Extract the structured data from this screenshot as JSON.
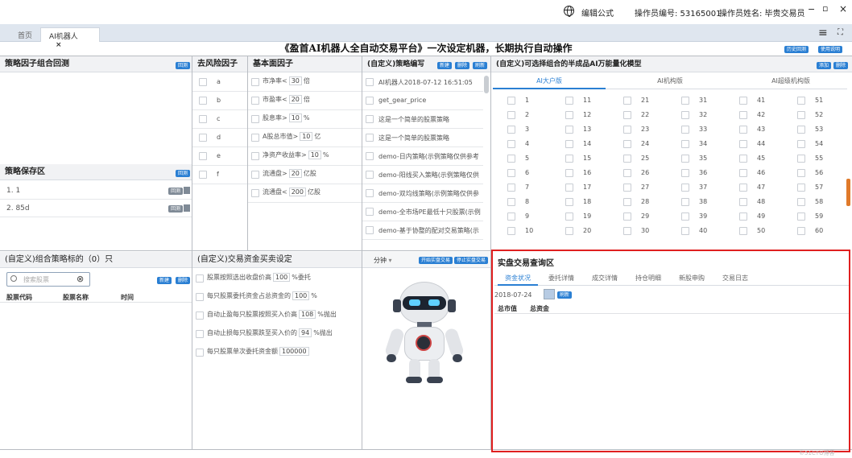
{
  "topbar": {
    "formula": "编辑公式",
    "operator_id": "操作员编号: 53165001",
    "operator_name": "操作员姓名: 毕贵交易员",
    "min": "−",
    "restore": "▫",
    "close": "×",
    "menu": "≡",
    "expand": "⛶"
  },
  "tabs": [
    {
      "label": "首页"
    },
    {
      "label": "AI机器人"
    }
  ],
  "tab_close": "×",
  "main_title": "《盈首AI机器人全自动交易平台》一次设定机器，长期执行自动操作",
  "header_buttons": {
    "history": "历史回测",
    "help": "使用说明"
  },
  "backtest": {
    "title": "策略因子组合回测",
    "btn": "回测"
  },
  "save": {
    "title": "策略保存区",
    "btn": "回测",
    "items": [
      {
        "label": "1.  1",
        "btn": "回测"
      },
      {
        "label": "2.  85d",
        "btn": "回测"
      }
    ]
  },
  "risk": {
    "title": "去风险因子",
    "items": [
      "a",
      "b",
      "c",
      "d",
      "e",
      "f"
    ]
  },
  "fundamental": {
    "title": "基本面因子",
    "items": [
      {
        "pre": "市净率<",
        "val": "30",
        "unit": "倍"
      },
      {
        "pre": "市盈率<",
        "val": "20",
        "unit": "倍"
      },
      {
        "pre": "股息率>",
        "val": "10",
        "unit": "%"
      },
      {
        "pre": "A股总市值>",
        "val": "10",
        "unit": "亿"
      },
      {
        "pre": "净资产收益率>",
        "val": "10",
        "unit": "%"
      },
      {
        "pre": "流通盘>",
        "val": "20",
        "unit": "亿股"
      },
      {
        "pre": "流通盘<",
        "val": "200",
        "unit": "亿股"
      }
    ]
  },
  "editor": {
    "title": "(自定义)策略编写",
    "btn_new": "新建",
    "btn_del": "删除",
    "btn_refresh": "刷新",
    "items": [
      "AI机器人2018-07-12 16:51:05",
      "get_gear_price",
      "这是一个简单的股票策略",
      "这是一个简单的股票策略",
      "demo-日内策略(示例策略仅供参考",
      "demo-阳线买入策略(示例策略仅供",
      "demo-双均线策略(示例策略仅供参",
      "demo-全市场PE最低十只股票(示例",
      "demo-基于协整的配对交易策略(示"
    ]
  },
  "ai_model": {
    "title": "(自定义)可选择组合的半成品AI万能量化模型",
    "btn_add": "添加",
    "btn_del": "删除",
    "tabs": [
      "AI大户版",
      "AI机构版",
      "AI超级机构版"
    ],
    "columns": [
      [
        "1",
        "2",
        "3",
        "4",
        "5",
        "6",
        "7",
        "8",
        "9",
        "10"
      ],
      [
        "11",
        "12",
        "13",
        "14",
        "15",
        "16",
        "17",
        "18",
        "19",
        "20"
      ],
      [
        "21",
        "22",
        "23",
        "24",
        "25",
        "26",
        "27",
        "28",
        "29",
        "30"
      ],
      [
        "31",
        "32",
        "33",
        "34",
        "35",
        "36",
        "37",
        "38",
        "39",
        "40"
      ],
      [
        "41",
        "42",
        "43",
        "44",
        "45",
        "46",
        "47",
        "48",
        "49",
        "50"
      ],
      [
        "51",
        "52",
        "53",
        "54",
        "55",
        "56",
        "57",
        "58",
        "59",
        "60"
      ]
    ]
  },
  "targets": {
    "title": "(自定义)组合策略标的（0）只",
    "search_placeholder": "搜索股票",
    "clear": "⊗",
    "btn_new": "新建",
    "btn_del": "删除",
    "cols": [
      "股票代码",
      "股票名称",
      "时间"
    ]
  },
  "trade": {
    "title": "(自定义)交易资金买卖设定",
    "items": [
      {
        "pre": "股票按照选出收盘价高",
        "val": "100",
        "unit": "%委托"
      },
      {
        "pre": "每只股票委托资金占总资金的",
        "val": "100",
        "unit": "%"
      },
      {
        "pre": "自动止盈每只股票按照买入价高",
        "val": "108",
        "unit": "%抛出"
      },
      {
        "pre": "自动止损每只股票跌至买入价的",
        "val": "94",
        "unit": "%抛出"
      },
      {
        "pre": "每只股票单次委托资金额",
        "val": "100000",
        "unit": ""
      }
    ]
  },
  "robot": {
    "minute": "分钟",
    "dd": "▾",
    "btn_start": "开始实盘交易",
    "btn_stop": "停止实盘交易"
  },
  "query": {
    "title": "实盘交易查询区",
    "tabs": [
      "资金状况",
      "委托详情",
      "成交详情",
      "持仓明细",
      "新股申购",
      "交易日志"
    ],
    "date": "2018-07-24",
    "btn_refresh": "刷新",
    "cols": [
      "总市值",
      "总资金"
    ]
  },
  "watermark": "©51CTO博客",
  "colors": {
    "accent": "#2a7fd3",
    "highlight": "#e02020"
  }
}
